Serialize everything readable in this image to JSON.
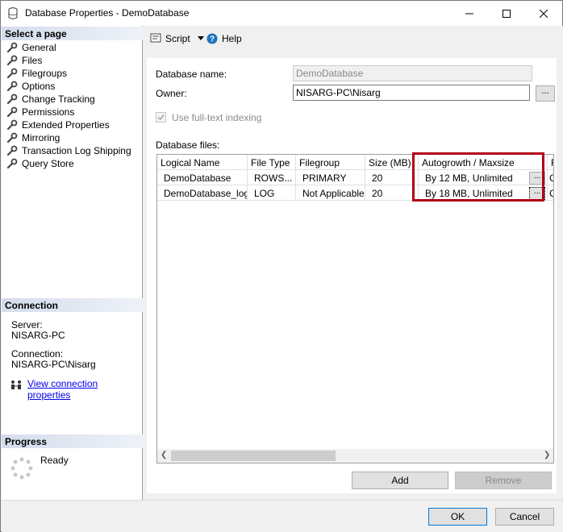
{
  "window": {
    "title": "Database Properties - DemoDatabase"
  },
  "left": {
    "select_page_header": "Select a page",
    "pages": [
      {
        "label": "General"
      },
      {
        "label": "Files"
      },
      {
        "label": "Filegroups"
      },
      {
        "label": "Options"
      },
      {
        "label": "Change Tracking"
      },
      {
        "label": "Permissions"
      },
      {
        "label": "Extended Properties"
      },
      {
        "label": "Mirroring"
      },
      {
        "label": "Transaction Log Shipping"
      },
      {
        "label": "Query Store"
      }
    ],
    "connection_header": "Connection",
    "server_label": "Server:",
    "server_value": "NISARG-PC",
    "connection_label": "Connection:",
    "connection_value": "NISARG-PC\\Nisarg",
    "view_connection_link": "View connection properties",
    "progress_header": "Progress",
    "progress_status": "Ready"
  },
  "toolbar": {
    "script_label": "Script",
    "help_label": "Help"
  },
  "form": {
    "db_name_label": "Database name:",
    "db_name_value": "DemoDatabase",
    "owner_label": "Owner:",
    "owner_value": "NISARG-PC\\Nisarg",
    "owner_browse": "...",
    "fulltext_label": "Use full-text indexing",
    "db_files_label": "Database files:"
  },
  "grid": {
    "columns": [
      "Logical Name",
      "File Type",
      "Filegroup",
      "Size (MB)",
      "Autogrowth / Maxsize",
      "F"
    ],
    "rows": [
      {
        "logical_name": "DemoDatabase",
        "file_type": "ROWS...",
        "filegroup": "PRIMARY",
        "size": "20",
        "autogrowth": "By 12 MB, Unlimited",
        "btn": "...",
        "extra": "C"
      },
      {
        "logical_name": "DemoDatabase_log",
        "file_type": "LOG",
        "filegroup": "Not Applicable",
        "size": "20",
        "autogrowth": "By 18 MB, Unlimited",
        "btn": "...",
        "extra": "C"
      }
    ]
  },
  "buttons": {
    "add": "Add",
    "remove": "Remove",
    "ok": "OK",
    "cancel": "Cancel"
  },
  "colors": {
    "highlight": "#b0001a",
    "link": "#0000ee",
    "help": "#1e73be"
  }
}
